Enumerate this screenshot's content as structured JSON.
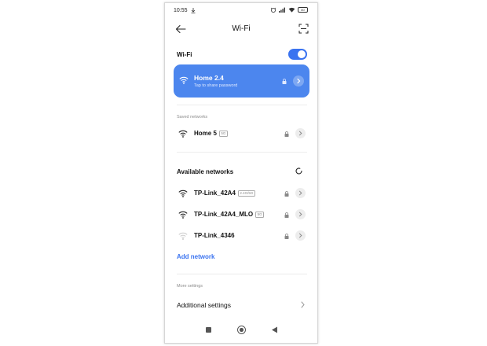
{
  "status_bar": {
    "time": "10:55",
    "battery": "80"
  },
  "header": {
    "title": "Wi-Fi"
  },
  "wifi_toggle": {
    "label": "Wi-Fi",
    "enabled": true
  },
  "connected": {
    "name": "Home 2.4",
    "subtitle": "Tap to share password"
  },
  "saved": {
    "section_label": "Saved networks",
    "networks": [
      {
        "name": "Home 5",
        "band": "5G"
      }
    ]
  },
  "available": {
    "section_title": "Available networks",
    "networks": [
      {
        "name": "TP-Link_42A4",
        "band": "2.4G/5G",
        "signal": "strong"
      },
      {
        "name": "TP-Link_42A4_MLO",
        "band": "5G",
        "signal": "strong"
      },
      {
        "name": "TP-Link_4346",
        "band": "",
        "signal": "weak"
      }
    ]
  },
  "add_network": "Add network",
  "more_settings": {
    "section_label": "More settings",
    "additional": "Additional settings"
  },
  "colors": {
    "accent": "#3a73f0",
    "connected_card": "#4c86ee"
  }
}
